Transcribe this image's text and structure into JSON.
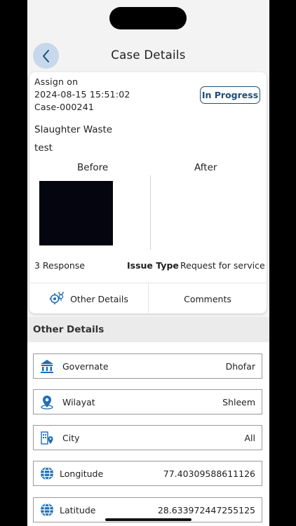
{
  "header": {
    "title": "Case Details"
  },
  "case": {
    "assign_label": "Assign on",
    "assign_date": "2024-08-15 15:51:02",
    "case_id": "Case-000241",
    "status": "In Progress",
    "category": "Slaughter Waste",
    "description": "test",
    "before_label": "Before",
    "after_label": "After",
    "responses": "3 Response",
    "issue_type_label": "Issue Type",
    "issue_type_value": "Request for service"
  },
  "tabs": {
    "other_details": "Other Details",
    "comments": "Comments"
  },
  "other_details": {
    "title": "Other Details",
    "rows": [
      {
        "label": "Governate",
        "value": "Dhofar",
        "icon": "government-building-icon"
      },
      {
        "label": "Wilayat",
        "value": "Shleem",
        "icon": "location-pin-icon"
      },
      {
        "label": "City",
        "value": "All",
        "icon": "city-building-icon"
      },
      {
        "label": "Longitude",
        "value": "77.40309588611126",
        "icon": "globe-icon"
      },
      {
        "label": "Latitude",
        "value": "28.633972447255125",
        "icon": "globe-icon"
      }
    ]
  },
  "colors": {
    "accent": "#1f4e79",
    "icon_blue": "#1f6fb5",
    "back_button_bg": "#c7d8ea"
  }
}
